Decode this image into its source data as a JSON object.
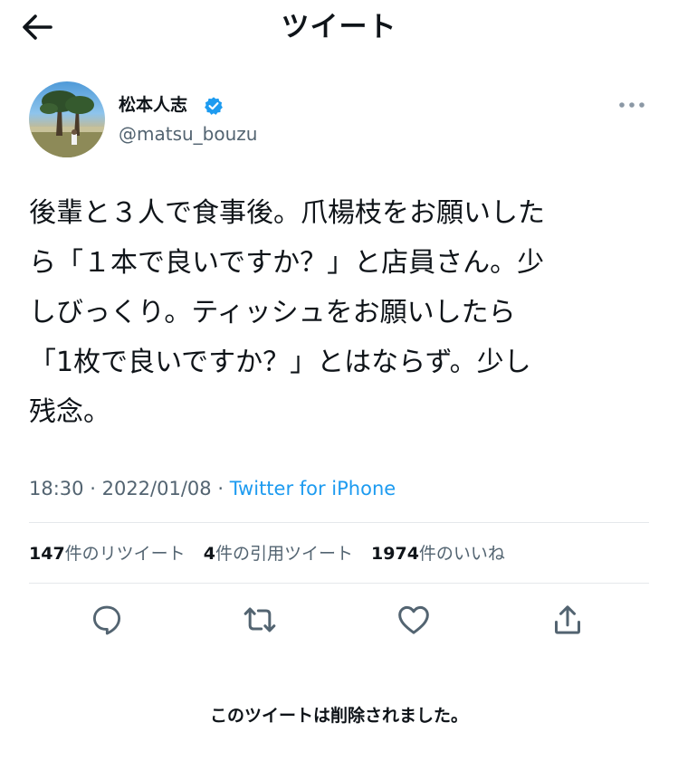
{
  "header": {
    "title": "ツイート",
    "back_icon": "arrow-left-icon"
  },
  "user": {
    "name": "松本人志",
    "handle": "@matsu_bouzu",
    "verified_color": "#1d9bf0"
  },
  "tweet": {
    "text": "後輩と３人で食事後。爪楊枝をお願いした\nら「１本で良いですか？」と店員さん。少\nしびっくり。ティッシュをお願いしたら\n「1枚で良いですか？」とはならず。少し\n残念。",
    "time": "18:30",
    "separator": "·",
    "date": "2022/01/08",
    "source": "Twitter for iPhone"
  },
  "stats": {
    "retweets": {
      "count": "147",
      "label": "件のリツイート"
    },
    "quotes": {
      "count": "4",
      "label": "件の引用ツイート"
    },
    "likes": {
      "count": "1974",
      "label": "件のいいね"
    }
  },
  "actions": [
    "reply-icon",
    "retweet-icon",
    "like-icon",
    "share-icon"
  ],
  "footer": {
    "deleted_notice": "このツイートは削除されました。"
  },
  "colors": {
    "text": "#0f1419",
    "secondary": "#536471",
    "accent": "#1d9bf0",
    "divider": "#e5e8eb"
  }
}
